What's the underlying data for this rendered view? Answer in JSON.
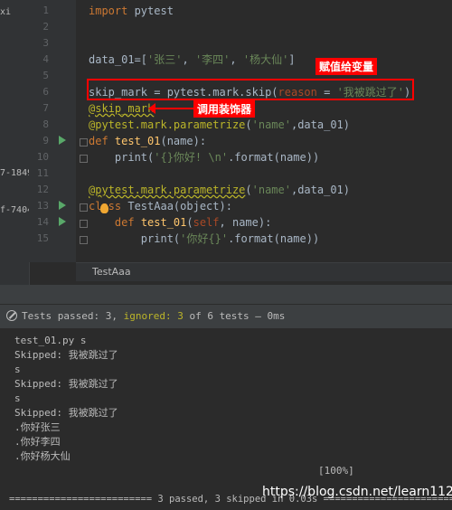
{
  "left_fragments": [
    "xi",
    "7-1849",
    "f-7404"
  ],
  "line_numbers": [
    "1",
    "2",
    "3",
    "4",
    "5",
    "6",
    "7",
    "8",
    "9",
    "10",
    "11",
    "12",
    "13",
    "14",
    "15"
  ],
  "code": {
    "l1_kw": "import",
    "l1_rest": " pytest",
    "l4_var": "data_01",
    "l4_eq": "=[",
    "l4_s1": "'张三'",
    "l4_c1": ", ",
    "l4_s2": "'李四'",
    "l4_c2": ", ",
    "l4_s3": "'杨大仙'",
    "l4_end": "]",
    "l6_a": "skip_mark = pytest.mark.skip(",
    "l6_param": "reason",
    "l6_eq": " = ",
    "l6_str": "'我被跳过了'",
    "l6_end": ")",
    "l7": "@skip_mark",
    "l8_dec": "@pytest.mark.parametrize",
    "l8_open": "(",
    "l8_str": "'name'",
    "l8_rest": ",data_01)",
    "l9_kw": "def ",
    "l9_fn": "test_01",
    "l9_rest": "(name):",
    "l10_pre": "    print(",
    "l10_str": "'{}你好! \\n'",
    "l10_rest": ".format(name))",
    "l13_dec": "@pytest.mark.parametrize",
    "l13_open": "(",
    "l13_str": "'name'",
    "l13_rest": ",data_01)",
    "l14_kw": "class ",
    "l14_rest": "TestAaa(object):",
    "l15_pre": "    ",
    "l15_kw": "def ",
    "l15_fn": "test_01",
    "l15_open": "(",
    "l15_self": "self",
    "l15_rest": ", name):",
    "l16_pre": "        print(",
    "l16_str": "'你好{}'",
    "l16_rest": ".format(name))"
  },
  "annotations": {
    "assign": "赋值给变量",
    "decorator": "调用装饰器"
  },
  "breadcrumb": "TestAaa",
  "status": {
    "passed": "Tests passed: 3,",
    "ignored": "ignored: 3",
    "rest": " of 6 tests – 0ms"
  },
  "console": [
    "test_01.py s",
    "Skipped: 我被跳过了",
    "s",
    "Skipped: 我被跳过了",
    "s",
    "Skipped: 我被跳过了",
    ".你好张三",
    ".你好李四",
    ".你好杨大仙",
    "[100%]",
    "========================= 3 passed, 3 skipped in 0.03s ========================"
  ],
  "watermark": "https://blog.csdn.net/learn112",
  "colors": {
    "keyword": "#cc7832",
    "string": "#6a8759",
    "decorator": "#bbb529",
    "function": "#ffc66d",
    "annotation": "#ff0000",
    "run": "#59a869"
  }
}
